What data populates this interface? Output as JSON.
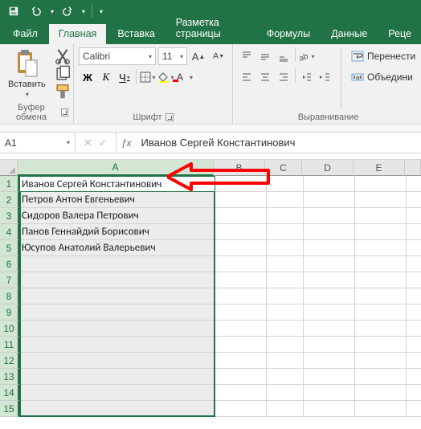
{
  "qat": {
    "save": "save-icon",
    "undo": "undo-icon",
    "redo": "redo-icon"
  },
  "tabs": {
    "file": "Файл",
    "home": "Главная",
    "insert": "Вставка",
    "layout": "Разметка страницы",
    "formulas": "Формулы",
    "data": "Данные",
    "review": "Реце"
  },
  "ribbon": {
    "clipboard": {
      "paste": "Вставить",
      "group": "Буфер обмена"
    },
    "font": {
      "name": "Calibri",
      "size": "11",
      "group": "Шрифт",
      "bold": "Ж",
      "italic": "К",
      "underline": "Ч"
    },
    "align": {
      "wrap": "Перенести",
      "merge": "Объедини",
      "group": "Выравнивание"
    }
  },
  "namebox": "A1",
  "formula": "Иванов Сергей Константинович",
  "columns": [
    "A",
    "B",
    "C",
    "D",
    "E"
  ],
  "rows": [
    "1",
    "2",
    "3",
    "4",
    "5",
    "6",
    "7",
    "8",
    "9",
    "10",
    "11",
    "12",
    "13",
    "14",
    "15"
  ],
  "cells": {
    "A1": "Иванов Сергей Константинович",
    "A2": "Петров Антон Евгеньевич",
    "A3": "Сидоров Валера Петрович",
    "A4": "Панов Геннайдий Борисович",
    "A5": "Юсупов Анатолий Валерьевич"
  },
  "selection": {
    "col": "A",
    "rows": 15,
    "active": "A1"
  }
}
